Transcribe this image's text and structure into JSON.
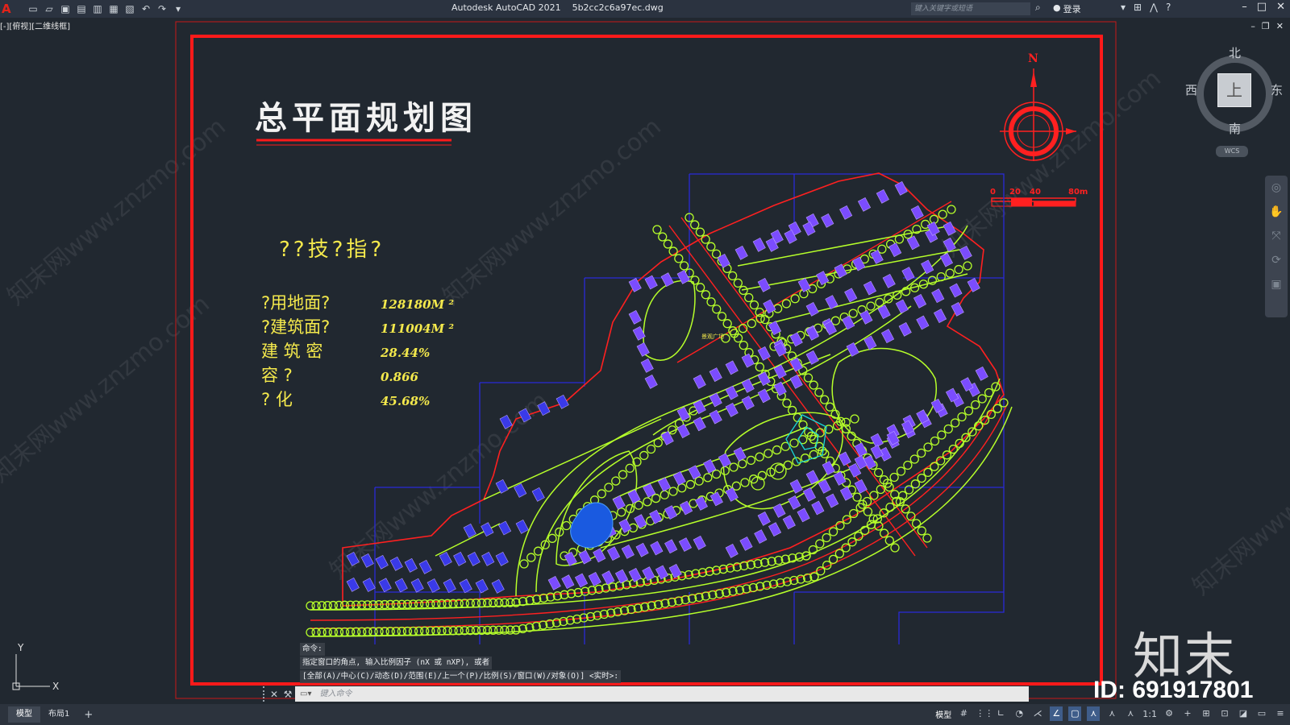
{
  "app": {
    "window_title": "Autodesk AutoCAD 2021    5b2cc2c6a97ec.dwg",
    "search_placeholder": "键入关键字或短语",
    "user_label": "登录",
    "viewport_label": "[-][俯视][二维线框]"
  },
  "drawing": {
    "title": "总平面规划图",
    "indicators_heading": "??技?指?",
    "indicators": [
      {
        "label": "?用地面?",
        "value": "128180M ²"
      },
      {
        "label": "?建筑面?",
        "value": "111004M ²"
      },
      {
        "label": "建  筑  密",
        "value": "28.44%"
      },
      {
        "label": "容      ?",
        "value": "0.866"
      },
      {
        "label": "?      化",
        "value": "45.68%"
      }
    ],
    "north_label": "N",
    "scale_labels": [
      "0",
      "20",
      "40",
      "80m"
    ],
    "plaza_label": "景观广场",
    "watermark_text": "知末网www.znzmo.com"
  },
  "viewcube": {
    "north": "北",
    "south": "南",
    "west": "西",
    "east": "东",
    "face": "上",
    "wcs": "WCS"
  },
  "ucs": {
    "x": "X",
    "y": "Y"
  },
  "command": {
    "history": [
      "命令:",
      "指定窗口的角点, 输入比例因子 (nX 或 nXP), 或者",
      "[全部(A)/中心(C)/动态(D)/范围(E)/上一个(P)/比例(S)/窗口(W)/对象(O)] <实时>:"
    ],
    "input_placeholder": "键入命令"
  },
  "statusbar": {
    "tabs": [
      "模型",
      "布局1"
    ],
    "add_tab": "+",
    "model_label": "模型",
    "scale": "1:1"
  },
  "watermark": {
    "logo": "知末",
    "id": "ID: 691917801"
  },
  "colors": {
    "background": "#212830",
    "frame_red": "#ff1a1a",
    "block_blue": "#2a2ad8",
    "building_purple": "#7b4cff",
    "tree_green": "#b6ff2a",
    "road_yellow": "#f5f07a",
    "title_white": "#f2f2f2"
  }
}
